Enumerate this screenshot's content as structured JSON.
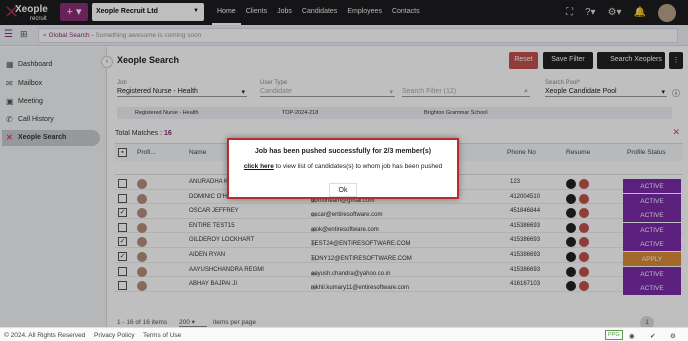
{
  "topbar": {
    "logo_text": "Xeople",
    "logo_sub": "recruit",
    "company": "Xeople Recruit Ltd",
    "nav": [
      "Home",
      "Clients",
      "Jobs",
      "Candidates",
      "Employees",
      "Contacts"
    ]
  },
  "search": {
    "label": "Global Search",
    "placeholder": "Something awesome is coming soon"
  },
  "sidebar": {
    "items": [
      "Dashboard",
      "Mailbox",
      "Meeting",
      "Call History",
      "Xeople Search"
    ]
  },
  "page": {
    "title": "Xeople Search",
    "reset": "Reset",
    "save_filter": "Save Filter",
    "search_xeoplers": "Search Xeoplers"
  },
  "filters": {
    "job_label": "Job",
    "job_value": "Registered Nurse - Health",
    "usertype_label": "User Type",
    "usertype_value": "Candidate",
    "searchfilter_placeholder": "Search Filter (12)",
    "pool_label": "Search Pool*",
    "pool_value": "Xeople Candidate Pool",
    "chips": [
      "Registered Nurse - Health",
      "TOP-2024-218",
      "Brighton Grammar School"
    ]
  },
  "table": {
    "total_label": "Total Matches :",
    "total": "16",
    "headers": [
      "Profi...",
      "Name",
      "Phone No",
      "Resume",
      "Profile Status"
    ],
    "rows": [
      {
        "name": "ANURADHA K",
        "email": "",
        "phone": "123",
        "status": "ACTIVE",
        "checked": false
      },
      {
        "name": "DOMINIC O'HEARN",
        "email": "domoheam@gmail.com",
        "phone": "412004510",
        "status": "ACTIVE",
        "checked": false
      },
      {
        "name": "OSCAR JEFFREY",
        "email": "oscar@entiresoftware.com",
        "phone": "451846844",
        "status": "ACTIVE",
        "checked": true
      },
      {
        "name": "ENTIRE TEST15",
        "email": "alok@entiresoftware.com",
        "phone": "415386693",
        "status": "ACTIVE",
        "checked": false
      },
      {
        "name": "GILDEROY LOCKHART",
        "email": "TEST24@ENTIRESOFTWARE.COM",
        "phone": "415386693",
        "status": "ACTIVE",
        "checked": true
      },
      {
        "name": "AIDEN RYAN",
        "email": "TONY12@ENTIRESOFTWARE.COM",
        "phone": "415386693",
        "status": "APPLY",
        "checked": true
      },
      {
        "name": "AAYUSHCHANDRA REGMI",
        "email": "aayush.chandra@yahoo.co.in",
        "phone": "415386693",
        "status": "ACTIVE",
        "checked": false
      },
      {
        "name": "ABHAY BAJPAI JI",
        "email": "nikhil.kumary11@entiresoftware.com",
        "phone": "416167103",
        "status": "ACTIVE",
        "checked": false
      }
    ]
  },
  "pager": {
    "range": "1 - 16 of 16 items",
    "page_size": "200",
    "per_page": "items per page",
    "current": "1"
  },
  "footer": {
    "copyright": "© 2024. All Rights Reserved",
    "privacy": "Privacy Policy",
    "terms": "Terms of Use",
    "badge": "PPG"
  },
  "modal": {
    "message": "Job has been pushed successfully for 2/3 member(s)",
    "link": "click here",
    "sub": " to view list of candidates(s) to whom job has been pushed",
    "ok": "Ok"
  },
  "colors": {
    "brand": "#8a2e78",
    "active": "#7a2aa8",
    "apply": "#d88a3a",
    "danger": "#c0504d"
  }
}
